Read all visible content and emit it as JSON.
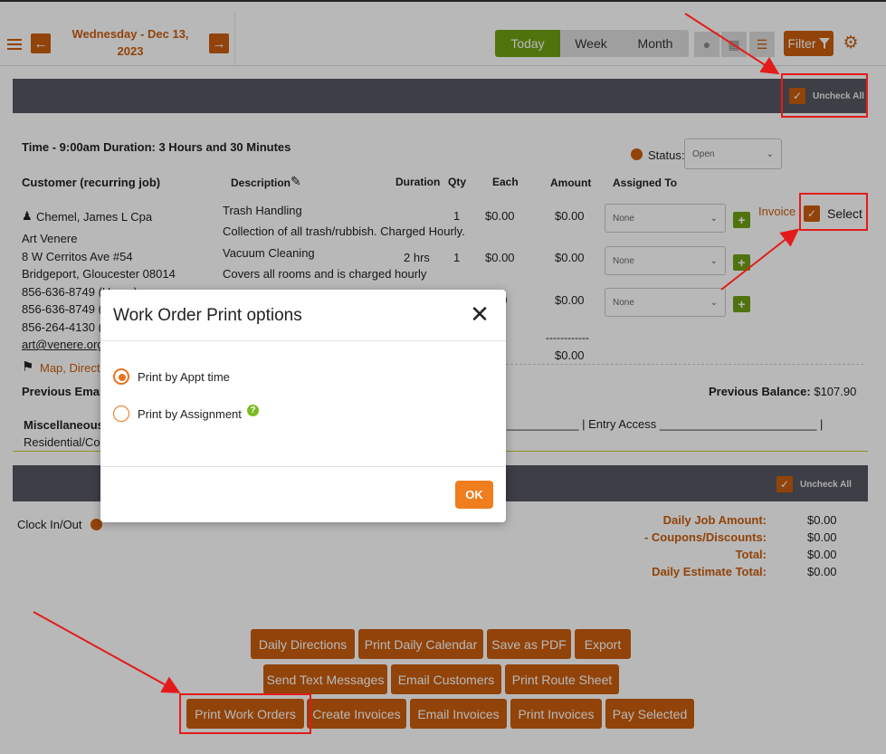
{
  "header": {
    "date_line1": "Wednesday - Dec 13,",
    "date_line2": "2023",
    "views": [
      "Today",
      "Week",
      "Month"
    ],
    "filter_label": "Filter"
  },
  "top_bar": {
    "uncheck_all_label": "Uncheck All"
  },
  "job": {
    "time_line": "Time - 9:00am Duration: 3 Hours and 30 Minutes",
    "status_label": "Status:",
    "status_value": "Open",
    "columns": {
      "customer": "Customer (recurring job)",
      "description": "Description",
      "duration": "Duration",
      "qty": "Qty",
      "each": "Each",
      "amount": "Amount",
      "assigned_to": "Assigned To"
    },
    "customer": {
      "name": "Chemel, James L Cpa",
      "company": "Art Venere",
      "address1": "8 W Cerritos Ave #54",
      "address2": "Bridgeport, Gloucester 08014",
      "phone_home": "856-636-8749 (Home)",
      "phone2": "856-636-8749 (",
      "phone3": "856-264-4130 (",
      "email": "art@venere.org",
      "map_link": "Map, Direct"
    },
    "lines": [
      {
        "title": "Trash Handling",
        "note": "Collection of all trash/rubbish. Charged Hourly.",
        "duration": "",
        "qty": "1",
        "each": "$0.00",
        "amount": "$0.00",
        "assigned": "None"
      },
      {
        "title": "Vacuum Cleaning",
        "note": "Covers all rooms and is charged hourly",
        "duration": "2 hrs",
        "qty": "1",
        "each": "$0.00",
        "amount": "$0.00",
        "assigned": "None"
      },
      {
        "title": "",
        "note": "",
        "duration": "",
        "qty": "",
        "each": "00",
        "amount": "$0.00",
        "assigned": "None"
      }
    ],
    "total_separator": "------------",
    "total_amount": "$0.00",
    "invoice_link": "Invoice",
    "select_label": "Select",
    "previous_email": "Previous Emai",
    "previous_balance_label": "Previous Balance:",
    "previous_balance_value": "$107.90",
    "misc_label": "Miscellaneous",
    "misc_tail": "___________ | Entry Access ________________________ |",
    "residential": "Residential/Co"
  },
  "bottom_bar": {
    "uncheck_all_label": "Uncheck All"
  },
  "summary": {
    "clock_label": "Clock In/Out",
    "rows": [
      {
        "label": "Daily Job Amount:",
        "value": "$0.00"
      },
      {
        "label": "- Coupons/Discounts:",
        "value": "$0.00"
      },
      {
        "label": "Total:",
        "value": "$0.00"
      },
      {
        "label": "Daily Estimate Total:",
        "value": "$0.00"
      }
    ]
  },
  "actions": {
    "row1": [
      "Daily Directions",
      "Print Daily Calendar",
      "Save as PDF",
      "Export"
    ],
    "row2": [
      "Send Text Messages",
      "Email Customers",
      "Print Route Sheet"
    ],
    "row3": [
      "Print Work Orders",
      "Create Invoices",
      "Email Invoices",
      "Print Invoices",
      "Pay Selected"
    ]
  },
  "modal": {
    "title": "Work Order Print options",
    "options": [
      {
        "label": "Print by Appt time",
        "selected": true
      },
      {
        "label": "Print by Assignment",
        "selected": false
      }
    ],
    "ok_label": "OK"
  },
  "colors": {
    "accent": "#c95d0e",
    "green": "#6fa014",
    "annotation_red": "#e31b1b"
  }
}
